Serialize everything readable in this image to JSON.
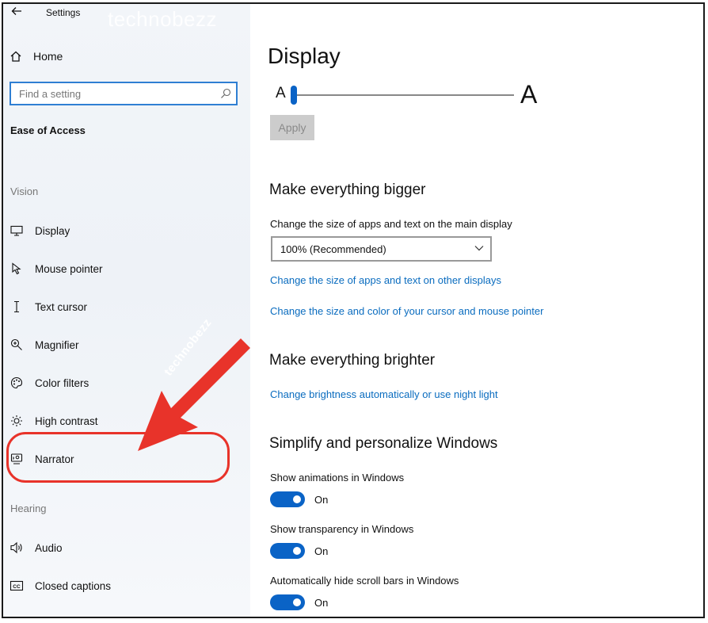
{
  "window": {
    "title": "Settings",
    "watermark": "technobezz"
  },
  "sidebar": {
    "home_label": "Home",
    "search_placeholder": "Find a setting",
    "section": "Ease of Access",
    "groups": {
      "vision": "Vision",
      "hearing": "Hearing"
    },
    "items": [
      {
        "label": "Display",
        "icon": "monitor-icon"
      },
      {
        "label": "Mouse pointer",
        "icon": "mouse-pointer-icon"
      },
      {
        "label": "Text cursor",
        "icon": "text-cursor-icon"
      },
      {
        "label": "Magnifier",
        "icon": "magnifier-icon"
      },
      {
        "label": "Color filters",
        "icon": "color-palette-icon"
      },
      {
        "label": "High contrast",
        "icon": "sun-icon"
      },
      {
        "label": "Narrator",
        "icon": "narrator-icon"
      },
      {
        "label": "Audio",
        "icon": "speaker-icon"
      },
      {
        "label": "Closed captions",
        "icon": "captions-icon"
      }
    ]
  },
  "annotation": {
    "arrow_text": "technobezz",
    "color": "#e8332a"
  },
  "main": {
    "title": "Display",
    "text_size": {
      "small_label": "A",
      "large_label": "A",
      "apply_label": "Apply"
    },
    "bigger": {
      "heading": "Make everything bigger",
      "scale_label": "Change the size of apps and text on the main display",
      "scale_value": "100% (Recommended)",
      "link_other_displays": "Change the size of apps and text on other displays",
      "link_cursor": "Change the size and color of your cursor and mouse pointer"
    },
    "brighter": {
      "heading": "Make everything brighter",
      "link_brightness": "Change brightness automatically or use night light"
    },
    "simplify": {
      "heading": "Simplify and personalize Windows",
      "toggles": [
        {
          "label": "Show animations in Windows",
          "state": "On"
        },
        {
          "label": "Show transparency in Windows",
          "state": "On"
        },
        {
          "label": "Automatically hide scroll bars in Windows",
          "state": "On"
        }
      ]
    }
  },
  "colors": {
    "accent": "#0a63c6",
    "link": "#0a6cbf",
    "search_border": "#2f7fd3"
  }
}
